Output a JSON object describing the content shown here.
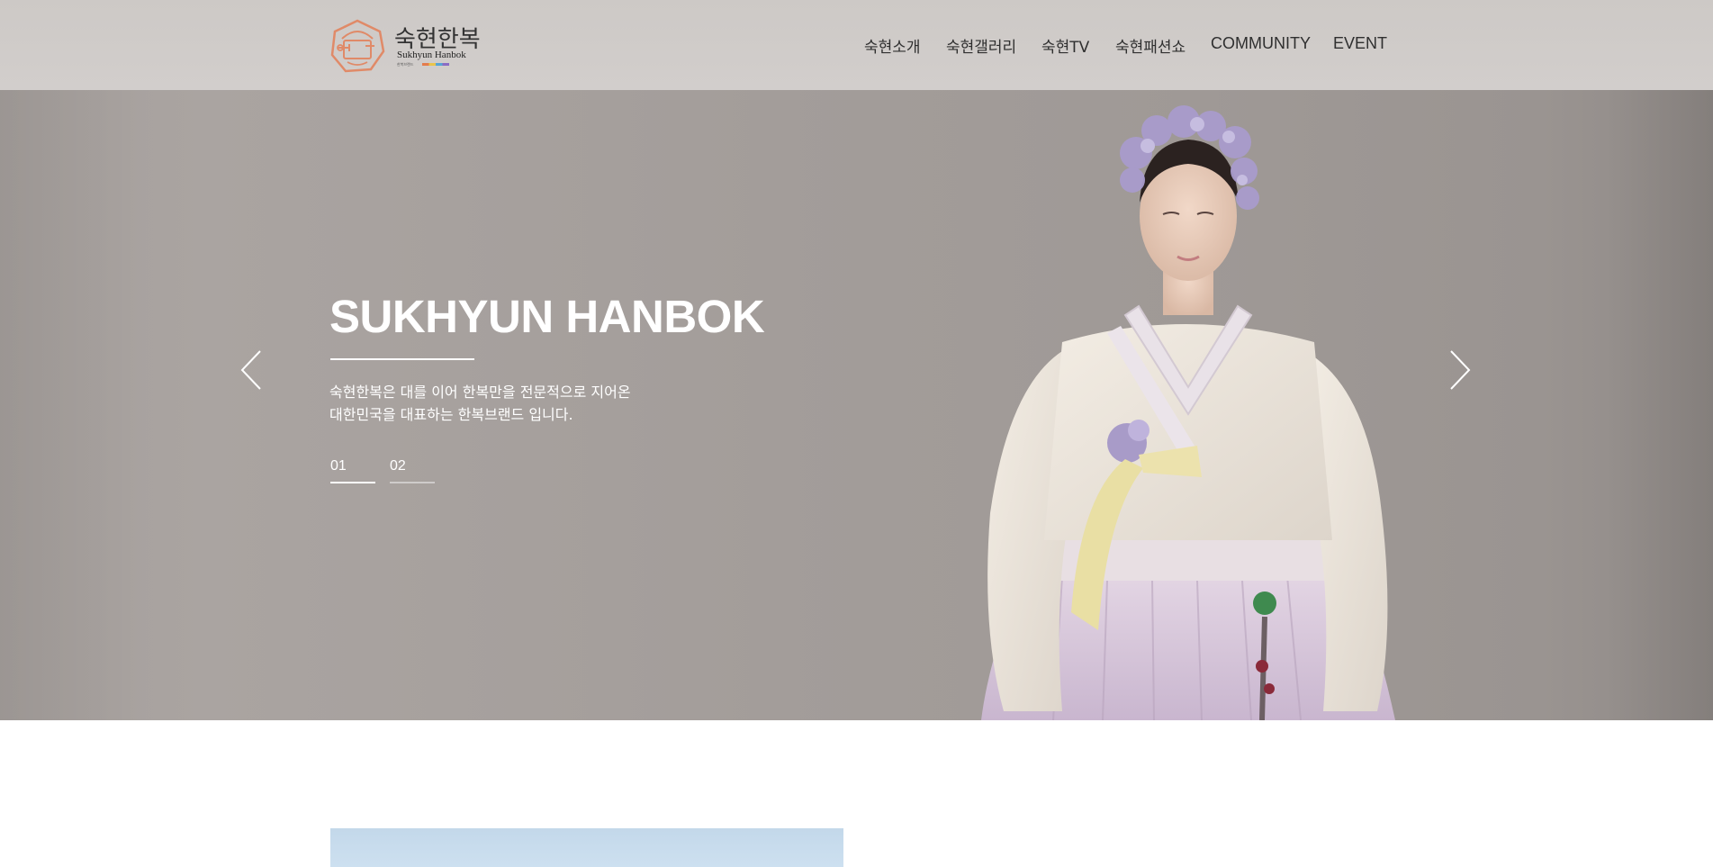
{
  "brand": {
    "name_ko": "숙현한복",
    "name_en": "Sukhyun Hanbok",
    "tagline_small": "한복브랜드"
  },
  "nav": {
    "items": [
      {
        "label": "숙현소개"
      },
      {
        "label": "숙현갤러리"
      },
      {
        "label": "숙현TV"
      },
      {
        "label": "숙현패션쇼"
      },
      {
        "label": "COMMUNITY"
      },
      {
        "label": "EVENT"
      }
    ]
  },
  "hero": {
    "title": "SUKHYUN HANBOK",
    "desc_line1": "숙현한복은 대를 이어 한복만을 전문적으로 지어온",
    "desc_line2": "대한민국을 대표하는 한복브랜드 입니다.",
    "slides": [
      {
        "label": "01",
        "active": true
      },
      {
        "label": "02",
        "active": false
      }
    ],
    "prev_icon": "chevron-left-icon",
    "next_icon": "chevron-right-icon"
  },
  "colors": {
    "header_bg": "#cfcbc8",
    "hero_bg": "#a39d9a",
    "logo_accent": "#e08a68",
    "text_dark": "#2f2f2f"
  }
}
